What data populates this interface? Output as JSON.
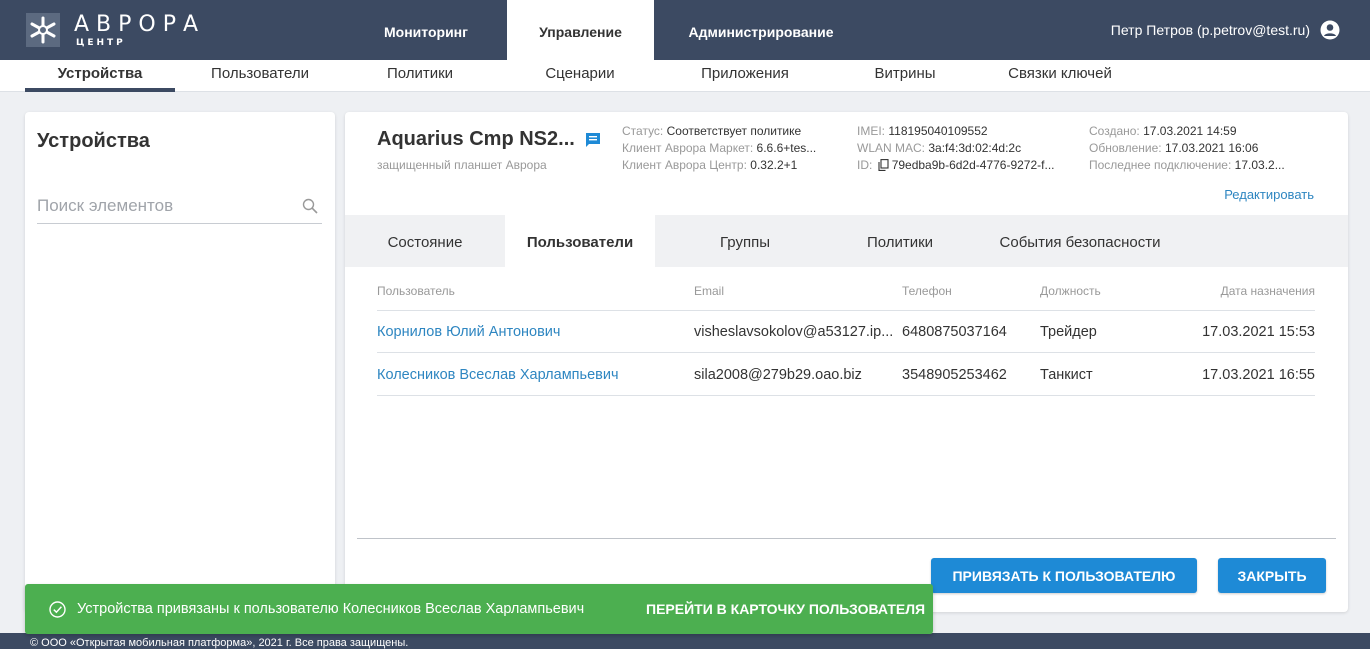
{
  "brand": {
    "name": "АВРОРА",
    "sub": "ЦЕНТР"
  },
  "main_tabs": [
    {
      "label": "Мониторинг"
    },
    {
      "label": "Управление"
    },
    {
      "label": "Администрирование"
    }
  ],
  "user": {
    "name": "Петр Петров (p.petrov@test.ru)"
  },
  "sub_tabs": [
    {
      "label": "Устройства"
    },
    {
      "label": "Пользователи"
    },
    {
      "label": "Политики"
    },
    {
      "label": "Сценарии"
    },
    {
      "label": "Приложения"
    },
    {
      "label": "Витрины"
    },
    {
      "label": "Связки ключей"
    }
  ],
  "left_panel": {
    "title": "Устройства",
    "search_placeholder": "Поиск элементов"
  },
  "device": {
    "name": "Aquarius Cmp NS2...",
    "subtitle": "защищенный планшет Аврора",
    "status_label": "Статус:",
    "status_value": "Соответствует политике",
    "market_label": "Клиент Аврора Маркет:",
    "market_value": "6.6.6+tes...",
    "center_label": "Клиент Аврора Центр:",
    "center_value": "0.32.2+1",
    "imei_label": "IMEI:",
    "imei_value": "118195040109552",
    "wlan_label": "WLAN MAC:",
    "wlan_value": "3a:f4:3d:02:4d:2c",
    "id_label": "ID:",
    "id_value": "79edba9b-6d2d-4776-9272-f...",
    "created_label": "Создано:",
    "created_value": "17.03.2021 14:59",
    "updated_label": "Обновление:",
    "updated_value": "17.03.2021 16:06",
    "last_conn_label": "Последнее подключение:",
    "last_conn_value": "17.03.2...",
    "edit_label": "Редактировать"
  },
  "device_tabs": [
    {
      "label": "Состояние"
    },
    {
      "label": "Пользователи"
    },
    {
      "label": "Группы"
    },
    {
      "label": "Политики"
    },
    {
      "label": "События безопасности"
    }
  ],
  "table": {
    "columns": [
      "Пользователь",
      "Email",
      "Телефон",
      "Должность",
      "Дата назначения"
    ],
    "rows": [
      [
        "Корнилов Юлий Антонович",
        "visheslavsokolov@a53127.ip...",
        "6480875037164",
        "Трейдер",
        "17.03.2021 15:53"
      ],
      [
        "Колесников Всеслав Харлампьевич",
        "sila2008@279b29.oao.biz",
        "3548905253462",
        "Танкист",
        "17.03.2021 16:55"
      ]
    ]
  },
  "buttons": {
    "bind_user": "ПРИВЯЗАТЬ К ПОЛЬЗОВАТЕЛЮ",
    "close": "ЗАКРЫТЬ"
  },
  "toast": {
    "message": "Устройства привязаны к пользователю Колесников Всеслав Харлампьевич",
    "action": "ПЕРЕЙТИ В КАРТОЧКУ ПОЛЬЗОВАТЕЛЯ"
  },
  "footer": {
    "text": "© ООО «Открытая мобильная платформа», 2021 г. Все права защищены."
  },
  "colors": {
    "header_bg": "#3c4a62",
    "accent": "#1e8ad6",
    "link": "#2e86c1",
    "toast_bg": "#4caf50"
  },
  "icons": [
    "logo-mark-icon",
    "user-circle-icon",
    "search-icon",
    "chat-icon",
    "copy-icon",
    "check-circle-icon"
  ]
}
